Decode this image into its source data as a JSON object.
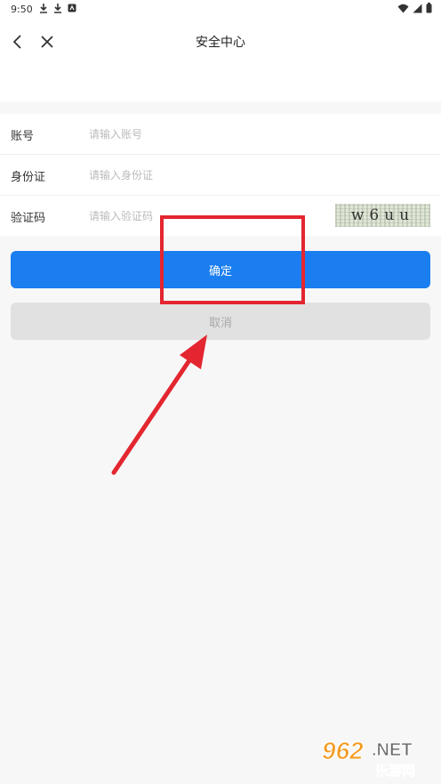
{
  "statusbar": {
    "time": "9:50",
    "icons": [
      "download-icon",
      "download-icon",
      "app-icon",
      "wifi-icon",
      "signal-icon",
      "battery-icon"
    ]
  },
  "nav": {
    "title": "安全中心",
    "back_icon": "chevron-left-icon",
    "close_icon": "close-icon"
  },
  "form": {
    "account": {
      "label": "账号",
      "placeholder": "请输入账号",
      "value": ""
    },
    "id_card": {
      "label": "身份证",
      "placeholder": "请输入身份证",
      "value": ""
    },
    "captcha": {
      "label": "验证码",
      "placeholder": "请输入验证码",
      "value": "",
      "image_text": "w6uu"
    }
  },
  "buttons": {
    "confirm": "确定",
    "cancel": "取消"
  },
  "colors": {
    "primary": "#1a7ef0",
    "cancel_bg": "#e1e1e1",
    "annotation": "#e32630"
  },
  "watermark": {
    "brand_number": "962",
    "brand_suffix": ".NET",
    "brand_cn": "乐游网"
  }
}
